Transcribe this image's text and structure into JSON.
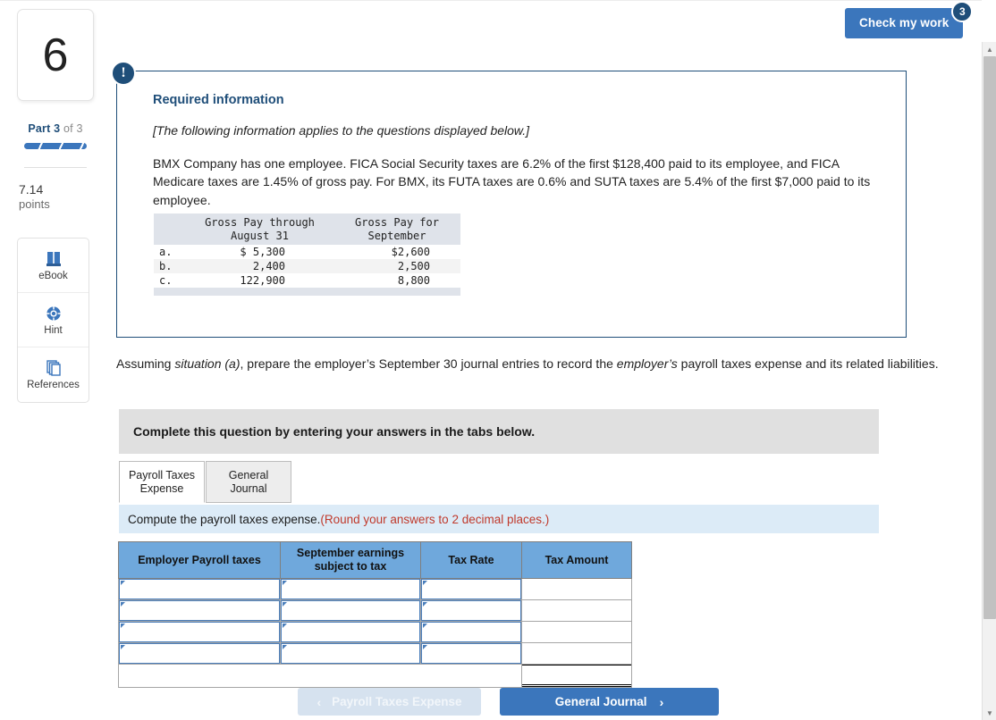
{
  "header": {
    "check_work_label": "Check my work",
    "check_work_badge": "3"
  },
  "rail": {
    "question_number": "6",
    "part_prefix": "Part",
    "part_current": "3",
    "part_suffix": "of 3",
    "points_value": "7.14",
    "points_label": "points",
    "tools": [
      {
        "icon": "book-icon",
        "label": "eBook"
      },
      {
        "icon": "lifebuoy-icon",
        "label": "Hint"
      },
      {
        "icon": "pages-stack-icon",
        "label": "References"
      }
    ]
  },
  "info": {
    "badge_glyph": "!",
    "title": "Required information",
    "italic_note": "[The following information applies to the questions displayed below.]",
    "body": "BMX Company has one employee. FICA Social Security taxes are 6.2% of the first $128,400 paid to its employee, and FICA Medicare taxes are 1.45% of gross pay. For BMX, its FUTA taxes are 0.6% and SUTA taxes are 5.4% of the first $7,000 paid to its employee.",
    "data_table": {
      "headers": [
        "",
        "Gross Pay through\nAugust 31",
        "Gross Pay for\nSeptember"
      ],
      "header_col1_line1": "Gross Pay through",
      "header_col1_line2": "August 31",
      "header_col2_line1": "Gross Pay for",
      "header_col2_line2": "September",
      "rows": [
        {
          "label": "a.",
          "through_aug": "$  5,300",
          "september": "$2,600"
        },
        {
          "label": "b.",
          "through_aug": "2,400",
          "september": "2,500"
        },
        {
          "label": "c.",
          "through_aug": "122,900",
          "september": "8,800"
        }
      ]
    }
  },
  "prompt": {
    "line1_a": "Assuming ",
    "line1_italic1": "situation (a)",
    "line1_b": ", prepare the employer’s September 30 journal entries to record the ",
    "line1_italic2": "employer’s",
    "line1_c": " payroll taxes expense and its related liabilities."
  },
  "instruction_bar": {
    "text": "Complete this question by entering your answers in the tabs below."
  },
  "tabs": [
    {
      "label_line1": "Payroll Taxes",
      "label_line2": "Expense",
      "active": true
    },
    {
      "label_line1": "General",
      "label_line2": "Journal",
      "active": false
    }
  ],
  "blue_strip": {
    "text": "Compute the payroll taxes expense. ",
    "red_text": "(Round your answers to 2 decimal places.)"
  },
  "answer_grid": {
    "columns": [
      {
        "line1": "Employer Payroll taxes",
        "line2": ""
      },
      {
        "line1": "September earnings",
        "line2": "subject to tax"
      },
      {
        "line1": "Tax Rate",
        "line2": ""
      },
      {
        "line1": "Tax Amount",
        "line2": ""
      }
    ],
    "rows": [
      {
        "employer_tax": "",
        "earnings": "",
        "rate": "",
        "amount": ""
      },
      {
        "employer_tax": "",
        "earnings": "",
        "rate": "",
        "amount": ""
      },
      {
        "employer_tax": "",
        "earnings": "",
        "rate": "",
        "amount": ""
      },
      {
        "employer_tax": "",
        "earnings": "",
        "rate": "",
        "amount": ""
      }
    ],
    "total_row": {
      "label": "",
      "amount": ""
    }
  },
  "nav": {
    "prev_label": "Payroll Taxes Expense",
    "prev_chevron": "‹",
    "next_label": "General Journal",
    "next_chevron": "›"
  },
  "scrollbar": {
    "up_glyph": "▲",
    "down_glyph": "▼"
  },
  "colors": {
    "accent_blue": "#3b76bc",
    "navy": "#1f4e79",
    "header_blue": "#6fa8dc",
    "strip_blue": "#dcebf7",
    "red": "#c0392b"
  }
}
